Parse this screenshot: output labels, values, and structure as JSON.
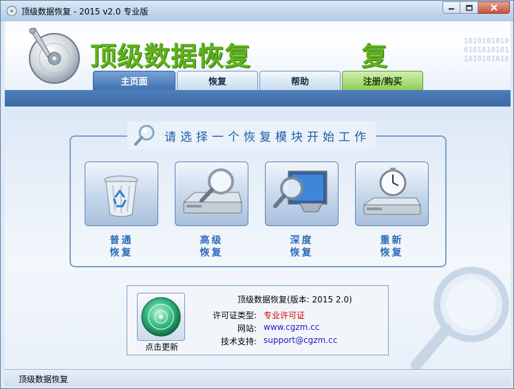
{
  "window": {
    "title": "顶级数据恢复 - 2015 v2.0 专业版"
  },
  "banner": {
    "brand": "顶级数据恢复",
    "brand_mark": "复",
    "binary_rows": [
      "1010101010",
      "0101010101",
      "1010101010"
    ]
  },
  "tabs": [
    {
      "label": "主页面",
      "active": true
    },
    {
      "label": "恢复",
      "active": false
    },
    {
      "label": "帮助",
      "active": false
    },
    {
      "label": "注册/购买",
      "active": false
    }
  ],
  "panel": {
    "title": "请选择一个恢复模块开始工作",
    "modules": [
      {
        "line1": "普通",
        "line2": "恢复",
        "icon": "recycle-bin-icon"
      },
      {
        "line1": "高级",
        "line2": "恢复",
        "icon": "drive-magnifier-icon"
      },
      {
        "line1": "深度",
        "line2": "恢复",
        "icon": "monitor-magnifier-icon"
      },
      {
        "line1": "重新",
        "line2": "恢复",
        "icon": "stopwatch-drive-icon"
      }
    ]
  },
  "info": {
    "update_label": "点击更新",
    "title": "顶级数据恢复(版本: 2015 2.0)",
    "rows": [
      {
        "key": "许可证类型:",
        "value": "专业许可证"
      },
      {
        "key": "网站:",
        "value": "www.cgzm.cc"
      },
      {
        "key": "技术支持:",
        "value": "support@cgzm.cc"
      }
    ]
  },
  "colors": {
    "license": "#d40000",
    "link": "#1a1ac8",
    "brand": "#60b31a"
  },
  "statusbar": {
    "text": "顶级数据恢复"
  }
}
